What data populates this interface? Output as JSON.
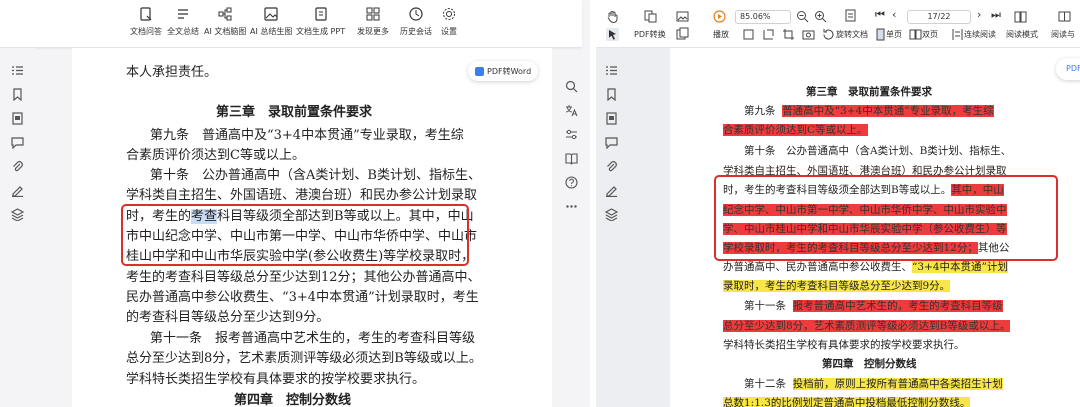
{
  "left_toolbar": {
    "items": [
      {
        "label": "文档问答",
        "icon": "doc-qa-icon"
      },
      {
        "label": "全文总结",
        "icon": "summary-icon"
      },
      {
        "label": "AI 文档脑图",
        "icon": "mindmap-icon"
      },
      {
        "label": "AI 总结生图",
        "icon": "image-gen-icon"
      },
      {
        "label": "文档生成 PPT",
        "icon": "ppt-icon"
      },
      {
        "label": "发现更多",
        "icon": "discover-icon"
      },
      {
        "label": "历史会话",
        "icon": "history-icon"
      },
      {
        "label": "设置",
        "icon": "gear-icon"
      }
    ]
  },
  "pdf_to_word": "PDF转Word",
  "left_doc": {
    "lines": [
      "本人承担责任。",
      "第三章　录取前置条件要求",
      "第九条　普通高中及“3+4中本贯通”专业录取，考生综",
      "合素质评价须达到C等或以上。",
      "第十条　公办普通高中（含A类计划、B类计划、指标生、",
      "学科类自主招生、外国语班、港澳台班）和民办参公计划录取",
      "时，考生的考查科目等级须全部达到B等或以上。其中，中山",
      "市中山纪念中学、中山市第一中学、中山市华侨中学、中山市",
      "桂山中学和中山市华辰实验中学(参公收费生)等学校录取时，",
      "考生的考查科目等级总分至少达到12分；其他公办普通高中、",
      "民办普通高中参公收费生、“3+4中本贯通”计划录取时，考生",
      "的考查科目等级总分至少达到9分。",
      "第十一条　报考普通高中艺术生的，考生的考查科目等级",
      "总分至少达到8分，艺术素质测评等级必须达到B等级或以上。",
      "学科特长类招生学校有具体要求的按学校要求执行。",
      "第四章　控制分数线"
    ],
    "line7_prefix": "时，考生的",
    "line7_highlight": "考查",
    "line7_suffix": "科目等级须全部达到B等或以上。其中，中山"
  },
  "right_toolbar": {
    "zoom": "85.06%",
    "page_indicator": "17/22",
    "row1": [
      {
        "label": "PDF转换",
        "icon": "pdf-convert-icon"
      },
      {
        "label": "播放",
        "icon": "play-icon"
      },
      {
        "label": "旋转文档",
        "icon": "rotate-icon"
      },
      {
        "label": "单页",
        "icon": "single-page-icon"
      },
      {
        "label": "双页",
        "icon": "double-page-icon"
      },
      {
        "label": "连续阅读",
        "icon": "continuous-icon"
      },
      {
        "label": "阅读模式",
        "icon": "read-mode-icon"
      },
      {
        "label": "阅读与",
        "icon": "read-icon"
      }
    ]
  },
  "right_doc": {
    "heading3": "第三章　录取前置条件要求",
    "a9_label": "第九条",
    "a9_red1": "普通高中及“3+4中本贯通”专业录取，考生综",
    "a9_red2": "合素质评价须达到C等或以上。",
    "a10_lines": [
      "第十条　公办普通高中（含A类计划、B类计划、指标生、",
      "学科类自主招生、外国语班、港澳台班）和民办参公计划录取"
    ],
    "a10_line3_plain": "时，考生的考查科目等级须全部达到B等或以上。",
    "a10_line3_red": "其中，中山",
    "a10_red_lines": [
      "纪念中学、中山市第一中学、中山市华侨中学、中山市实验中",
      "学、中山市桂山中学和中山市华辰实验中学（参公收费生）等",
      "学校录取时，考生的考查科目等级总分至少达到12分；"
    ],
    "a10_after_red": "其他公",
    "a10_line7_plain": "办普通高中、民办普通高中参公收费生、",
    "a10_line7_yellow": "“3+4中本贯通”计划",
    "a10_line8_yellow": "录取时，考生的考查科目等级总分至少达到9分。",
    "a11_label": "第十一条",
    "a11_red1": "报考普通高中艺术生的，考生的考查科目等级",
    "a11_red2": "总分至少达到8分，艺术素质测评等级必须达到B等级或以上。",
    "a11_line3": "学科特长类招生学校有具体要求的按学校要求执行。",
    "heading4": "第四章　控制分数线",
    "a12_label": "第十二条",
    "a12_yellow1": "投档前，原则上按所有普通高中各类招生计划",
    "a12_yellow2": "总数1:1.3的比例划定普通高中投档最低控制分数线。",
    "pdf_cut": "PDF"
  },
  "colors": {
    "red_box": "#d9302c",
    "red_highlight": "#ee3b3b",
    "yellow_highlight": "#f8e54a",
    "blue_selection": "#c9dcf6",
    "accent": "#3b7df5"
  }
}
